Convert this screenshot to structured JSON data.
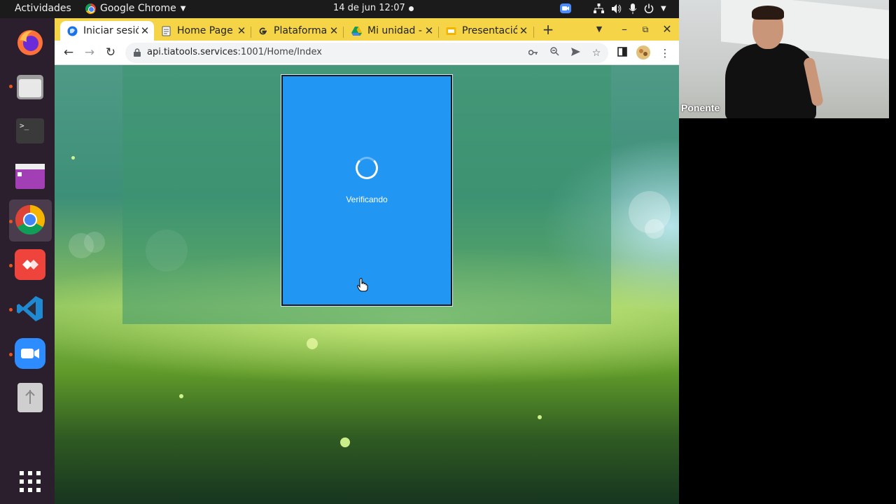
{
  "topbar": {
    "activities": "Actividades",
    "app_name": "Google Chrome",
    "clock": "14 de jun  12:07"
  },
  "dock": {
    "items": [
      "firefox-icon",
      "files-icon",
      "terminal-icon",
      "app-window-icon",
      "chrome-icon",
      "anydesk-icon",
      "vscode-icon",
      "zoom-icon",
      "usb-drive-icon",
      "show-apps-icon"
    ]
  },
  "browser": {
    "tabs": [
      {
        "title": "Iniciar sesión",
        "icon": "tiatools-icon"
      },
      {
        "title": "Home Page",
        "icon": "page-icon"
      },
      {
        "title": "Plataforma",
        "icon": "google-icon"
      },
      {
        "title": "Mi unidad -",
        "icon": "drive-icon"
      },
      {
        "title": "Presentació",
        "icon": "slides-icon"
      }
    ],
    "url_host": "api.tiatools.services",
    "url_path": ":1001/Home/Index"
  },
  "page": {
    "status_text": "Verificando"
  },
  "webcam": {
    "label": "Ponente"
  },
  "colors": {
    "tabbar": "#f5d547",
    "panel": "#2196f3",
    "dock": "#2b1f2d",
    "topbar": "#1b1b1b"
  }
}
